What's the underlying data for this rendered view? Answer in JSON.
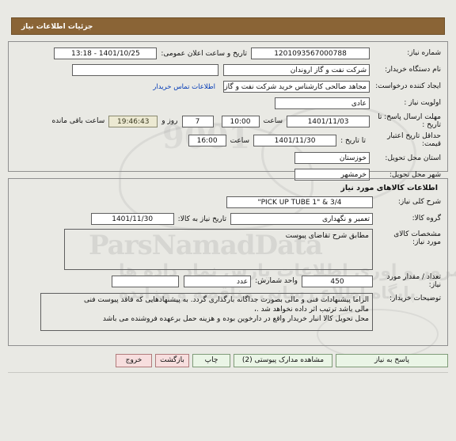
{
  "banner": {
    "title": "جزئیات اطلاعات نیاز"
  },
  "need_info": {
    "need_number": {
      "label": "شماره نیاز:",
      "value": "1201093567000788"
    },
    "public_announce": {
      "label": "تاریخ و ساعت اعلان عمومی:",
      "value": "1401/10/25 - 13:18"
    },
    "buyer_org": {
      "label": "نام دستگاه خریدار:",
      "value": "شرکت نفت و گاز اروندان"
    },
    "buyer_org_extra": {
      "value": ""
    },
    "requester": {
      "label": "ایجاد کننده درخواست:",
      "value": "مجاهد صالحی کارشناس خرید شرکت نفت و گاز اروندان"
    },
    "contact_link": {
      "label": "اطلاعات تماس خریدار"
    },
    "priority": {
      "label": "اولویت نیاز :",
      "value": "عادی"
    },
    "reply_deadline": {
      "label": "مهلت ارسال پاسخ: تا تاریخ :",
      "date": "1401/11/03",
      "time_label": "ساعت",
      "time": "10:00",
      "days": "7",
      "days_label": "روز و",
      "countdown": "19:46:43",
      "remaining_label": "ساعت باقی مانده"
    },
    "price_validity": {
      "label": "حداقل تاریخ اعتبار قیمت:",
      "date_label": "تا تاریخ :",
      "date": "1401/11/30",
      "time_label": "ساعت",
      "time": "16:00"
    },
    "province": {
      "label": "استان محل تحویل:",
      "value": "خوزستان"
    },
    "city": {
      "label": "شهر محل تحویل:",
      "value": "خرمشهر"
    }
  },
  "goods_info": {
    "title": "اطلاعات کالاهای مورد نیاز",
    "general_desc": {
      "label": "شرح کلی نیاز:",
      "value": "\"PICK UP TUBE 1\" & 3/4"
    },
    "group": {
      "label": "گروه کالا:",
      "value": "تعمیر و نگهداری"
    },
    "need_date": {
      "label": "تاریخ نیاز به کالا:",
      "value": "1401/11/30"
    },
    "specs": {
      "label": "مشخصات کالای مورد نیاز:",
      "value": "مطابق شرح تقاضای پیوست"
    },
    "quantity": {
      "label": "تعداد / مقدار مورد نیاز:",
      "value": "450"
    },
    "unit": {
      "label": "واحد شمارش:",
      "value": "عدد"
    },
    "unit_extra": {
      "value": ""
    },
    "buyer_notes": {
      "label": "توضیحات خریدار:",
      "line1": "الزاما  پیشنهادات فنی و مالی بصورت جداگانه بارگذاری گردد. به پیشنهادهایی که فاقد پیوست فنی",
      "line2": "مالی باشد ترتیب اثر داده نخواهد شد .،",
      "line3": "محل تحویل کالا انبار خریدار واقع در  دارخوین بوده و هزینه حمل برعهده فروشنده می باشد"
    }
  },
  "buttons": {
    "answer": "پاسخ به نیاز",
    "docs": "مشاهده مدارک پیوستی (2)",
    "print": "چاپ",
    "back": "بازگشت",
    "exit": "خروج"
  },
  "watermark": {
    "line1": "ParsNamadData",
    "line2": "مرور و اوری اطلاعات پارس نماد داده ها",
    "line3": "پایگاه اطلاع رسانی مناقصه و مزایده",
    "line4": "9001"
  },
  "colors": {
    "banner_bg": "#8a6436",
    "link": "#0039b6",
    "btn_green": "#eaf5e6",
    "btn_pink": "#f7dede",
    "countdown_bg": "#ece9d2"
  }
}
